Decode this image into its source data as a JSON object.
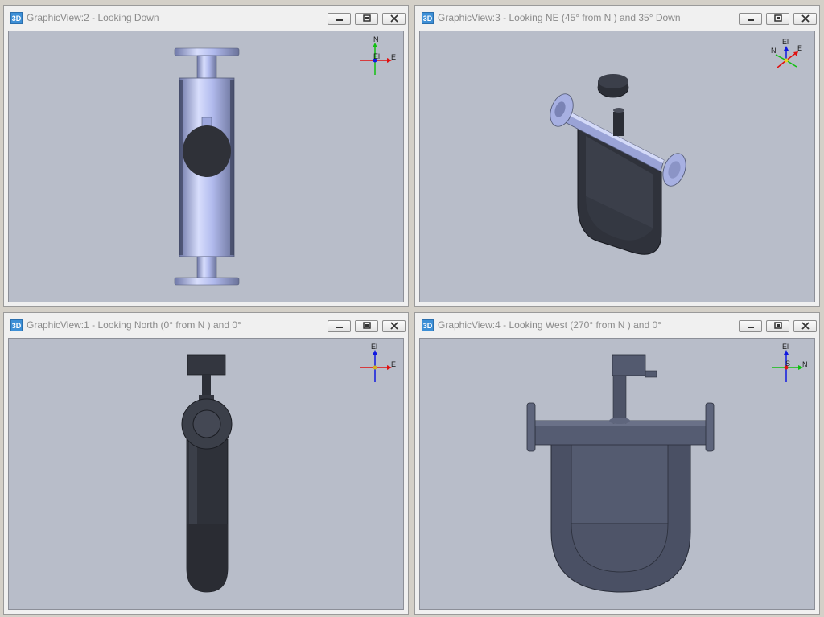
{
  "panes": [
    {
      "title": "GraphicView:2 - Looking Down",
      "icon": "3D",
      "axes": [
        "N",
        "El",
        "E"
      ]
    },
    {
      "title": "GraphicView:3 - Looking NE (45° from N ) and 35° Down",
      "icon": "3D",
      "axes": [
        "El",
        "N",
        "E"
      ]
    },
    {
      "title": "GraphicView:1 - Looking North (0° from N ) and 0°",
      "icon": "3D",
      "axes": [
        "El",
        "E"
      ]
    },
    {
      "title": "GraphicView:4 - Looking West (270° from N ) and 0°",
      "icon": "3D",
      "axes": [
        "El",
        "S",
        "N"
      ]
    }
  ],
  "colors": {
    "viewport_bg": "#b8bdc9",
    "metal_light": "#b4bdf0",
    "metal_dark": "#3f4452",
    "axis_red": "#e01010",
    "axis_green": "#10c010",
    "axis_blue": "#1018e0"
  }
}
